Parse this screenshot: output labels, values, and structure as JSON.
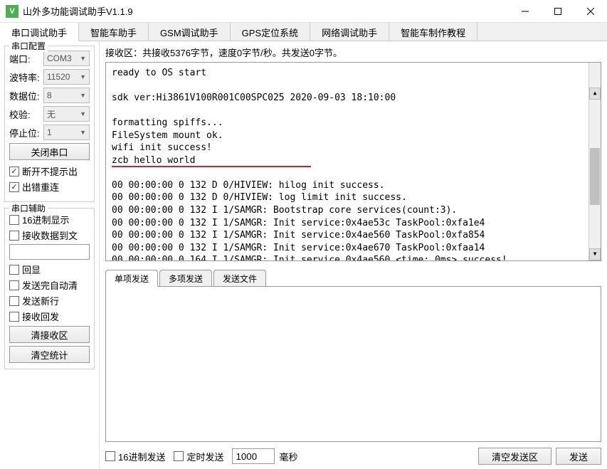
{
  "window": {
    "title": "山外多功能调试助手V1.1.9"
  },
  "tabs": [
    "串口调试助手",
    "智能车助手",
    "GSM调试助手",
    "GPS定位系统",
    "网络调试助手",
    "智能车制作教程"
  ],
  "active_tab": 0,
  "config": {
    "group_title": "串口配置",
    "port_label": "端口:",
    "port_value": "COM3",
    "baud_label": "波特率:",
    "baud_value": "11520",
    "databits_label": "数据位:",
    "databits_value": "8",
    "parity_label": "校验:",
    "parity_value": "无",
    "stopbits_label": "停止位:",
    "stopbits_value": "1",
    "close_btn": "关闭串口",
    "no_prompt_chk": "断开不提示出",
    "err_reconnect_chk": "出错重连"
  },
  "assist": {
    "group_title": "串口辅助",
    "hex_display_chk": "16进制显示",
    "recv_to_file_chk": "接收数据到文",
    "echo_chk": "回显",
    "auto_clear_chk": "发送完自动清",
    "send_newline_chk": "发送新行",
    "recv_echo_chk": "接收回发",
    "clear_rx_btn": "清接收区",
    "clear_stats_btn": "清空统计"
  },
  "rx": {
    "info": "接收区：共接收5376字节，速度0字节/秒。共发送0字节。",
    "lines": [
      "ready to OS start",
      "",
      "sdk ver:Hi3861V100R001C00SPC025 2020-09-03 18:10:00",
      "",
      "formatting spiffs...",
      "FileSystem mount ok.",
      "wifi init success!",
      "zcb hello world",
      "",
      "00 00:00:00 0 132 D 0/HIVIEW: hilog init success.",
      "00 00:00:00 0 132 D 0/HIVIEW: log limit init success.",
      "00 00:00:00 0 132 I 1/SAMGR: Bootstrap core services(count:3).",
      "00 00:00:00 0 132 I 1/SAMGR: Init service:0x4ae53c TaskPool:0xfa1e4",
      "00 00:00:00 0 132 I 1/SAMGR: Init service:0x4ae560 TaskPool:0xfa854",
      "00 00:00:00 0 132 I 1/SAMGR: Init service:0x4ae670 TaskPool:0xfaa14",
      "00 00:00:00 0 164 I 1/SAMGR: Init service 0x4ae560 <time: 0ms> success!"
    ]
  },
  "send_tabs": [
    "单项发送",
    "多项发送",
    "发送文件"
  ],
  "active_send_tab": 0,
  "bottom": {
    "hex_send_chk": "16进制发送",
    "timed_send_chk": "定时发送",
    "interval_value": "1000",
    "ms_label": "毫秒",
    "clear_send_btn": "清空发送区",
    "send_btn": "发送"
  }
}
